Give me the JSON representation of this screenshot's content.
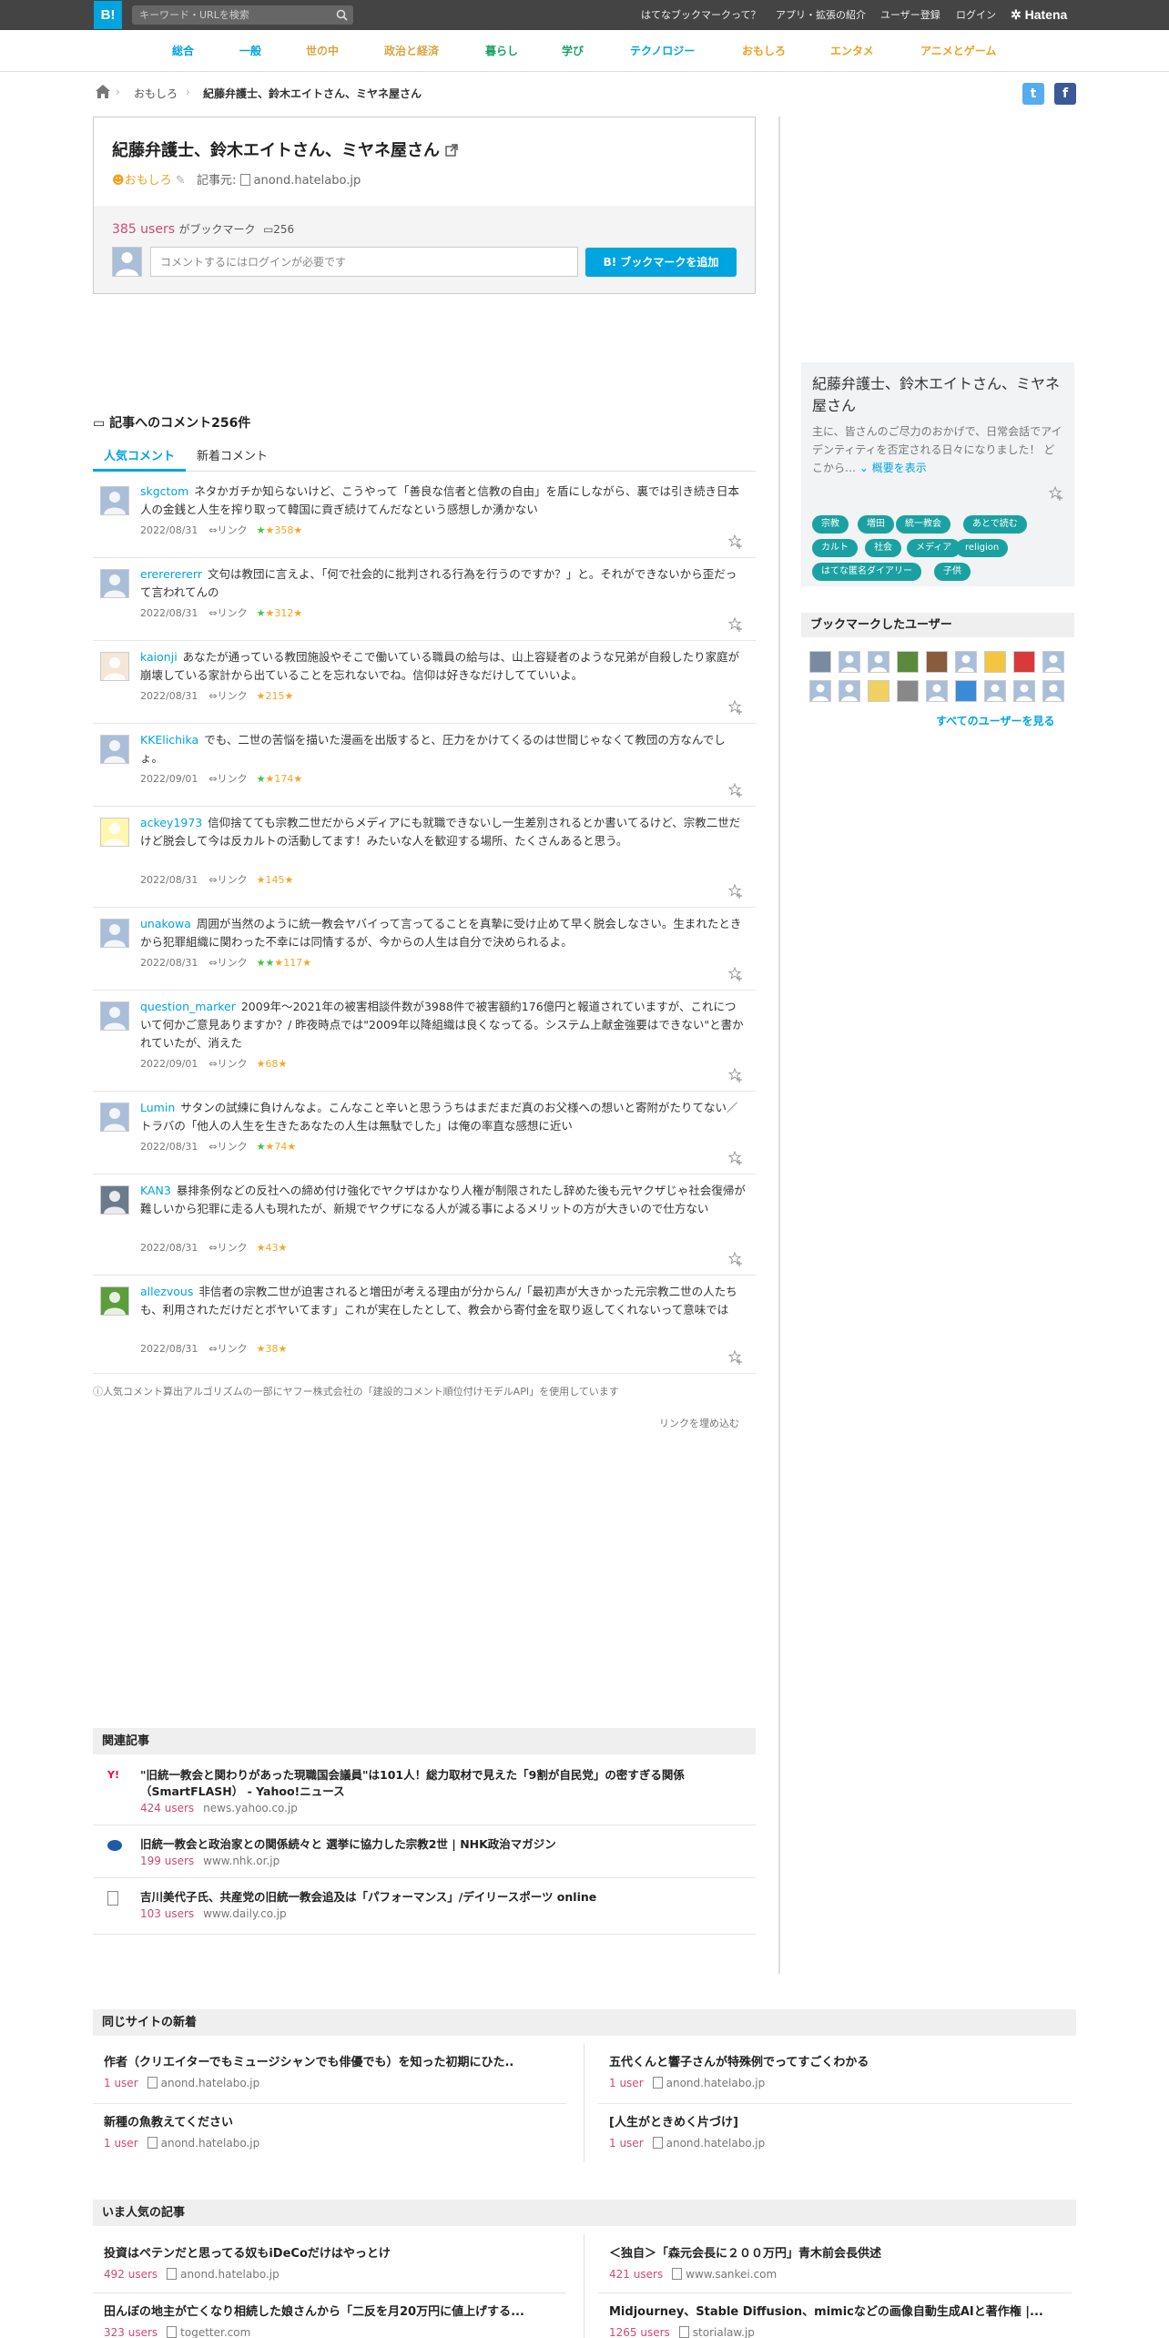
{
  "topbar": {
    "logo": "B!",
    "search_placeholder": "キーワード・URLを検索",
    "nav": [
      "はてなブックマークって？",
      "アプリ・拡張の紹介",
      "ユーザー登録",
      "ログイン"
    ],
    "brand": "Hatena"
  },
  "categories": [
    {
      "label": "総合",
      "color": "#00a4de"
    },
    {
      "label": "一般",
      "color": "#00a4de"
    },
    {
      "label": "世の中",
      "color": "#d9a441"
    },
    {
      "label": "政治と経済",
      "color": "#d9a441"
    },
    {
      "label": "暮らし",
      "color": "#1ba167"
    },
    {
      "label": "学び",
      "color": "#1ba167"
    },
    {
      "label": "テクノロジー",
      "color": "#00a4de"
    },
    {
      "label": "おもしろ",
      "color": "#f0a020"
    },
    {
      "label": "エンタメ",
      "color": "#f0a020"
    },
    {
      "label": "アニメとゲーム",
      "color": "#f0a020"
    }
  ],
  "breadcrumb": {
    "category": "おもしろ",
    "current": "紀藤弁護士、鈴木エイトさん、ミヤネ屋さん"
  },
  "entry": {
    "title": "紀藤弁護士、鈴木エイトさん、ミヤネ屋さん",
    "category": "おもしろ",
    "source_label": "記事元:",
    "source": "anond.hatelabo.jp",
    "users": "385 users",
    "bookmarked_suffix": "がブックマーク",
    "comment_count": "256",
    "comment_placeholder": "コメントするにはログインが必要です",
    "add_button": "ブックマークを追加"
  },
  "comments_section": {
    "heading": "記事へのコメント256件",
    "tab_popular": "人気コメント",
    "tab_new": "新着コメント"
  },
  "comments": [
    {
      "user": "skgctom",
      "text": "ネタかガチか知らないけど、こうやって「善良な信者と信教の自由」を盾にしながら、裏では引き続き日本人の金銭と人生を搾り取って韓国に貢ぎ続けてんだなという感想しか湧かない",
      "date": "2022/08/31",
      "link": "リンク",
      "stars": "358",
      "green": "★"
    },
    {
      "user": "erererererr",
      "text": "文句は教団に言えよ、「何で社会的に批判される行為を行うのですか？」と。それができないから歪だって言われてんの",
      "date": "2022/08/31",
      "link": "リンク",
      "stars": "312",
      "green": "★"
    },
    {
      "user": "kaionji",
      "text": "あなたが通っている教団施設やそこで働いている職員の給与は、山上容疑者のような兄弟が自殺したり家庭が崩壊している家計から出ていることを忘れないでね。信仰は好きなだけしてていいよ。",
      "date": "2022/08/31",
      "link": "リンク",
      "stars": "215",
      "green": ""
    },
    {
      "user": "KKElichika",
      "text": "でも、二世の苦悩を描いた漫画を出版すると、圧力をかけてくるのは世間じゃなくて教団の方なんでしょ。",
      "date": "2022/09/01",
      "link": "リンク",
      "stars": "174",
      "green": "★"
    },
    {
      "user": "ackey1973",
      "text": "信仰捨てても宗教二世だからメディアにも就職できないし一生差別されるとか書いてるけど、宗教二世だけど脱会して今は反カルトの活動してます！みたいな人を歓迎する場所、たくさんあると思う。",
      "date": "2022/08/31",
      "link": "リンク",
      "stars": "145",
      "green": ""
    },
    {
      "user": "unakowa",
      "text": "周囲が当然のように統一教会ヤバイって言ってることを真摯に受け止めて早く脱会しなさい。生まれたときから犯罪組織に関わった不幸には同情するが、今からの人生は自分で決められるよ。",
      "date": "2022/08/31",
      "link": "リンク",
      "stars": "117",
      "green": "★★"
    },
    {
      "user": "question_marker",
      "text": "2009年～2021年の被害相談件数が3988件で被害額約176億円と報道されていますが、これについて何かご意見ありますか？/ 昨夜時点では\"2009年以降組織は良くなってる。システム上献金強要はできない\"と書かれていたが、消えた",
      "date": "2022/09/01",
      "link": "リンク",
      "stars": "68",
      "green": ""
    },
    {
      "user": "Lumin",
      "text": "サタンの試練に負けんなよ。こんなこと辛いと思ううちはまだまだ真のお父様への想いと寄附がたりてない／トラバの「他人の人生を生きたあなたの人生は無駄でした」は俺の率直な感想に近い",
      "date": "2022/08/31",
      "link": "リンク",
      "stars": "74",
      "green": "★"
    },
    {
      "user": "KAN3",
      "text": "暴排条例などの反社への締め付け強化でヤクザはかなり人権が制限されたし辞めた後も元ヤクザじゃ社会復帰が難しいから犯罪に走る人も現れたが、新規でヤクザになる人が減る事によるメリットの方が大きいので仕方ない",
      "date": "2022/08/31",
      "link": "リンク",
      "stars": "43",
      "green": ""
    },
    {
      "user": "allezvous",
      "text": "非信者の宗教二世が迫害されると増田が考える理由が分からん/「最初声が大きかった元宗教二世の人たちも、利用されただけだとボヤいてます」これが実在したとして、教会から寄付金を取り返してくれないって意味では",
      "date": "2022/08/31",
      "link": "リンク",
      "stars": "38",
      "green": ""
    }
  ],
  "algo_note": "人気コメント算出アルゴリズムの一部にヤフー株式会社の「建設的コメント順位付けモデルAPI」を使用しています",
  "embed_link": "リンクを埋め込む",
  "related": {
    "heading": "関連記事",
    "items": [
      {
        "title": "\"旧統一教会と関わりがあった現職国会議員\"は101人！総力取材で見えた「9割が自民党」の密すぎる関係（SmartFLASH） - Yahoo!ニュース",
        "users": "424 users",
        "domain": "news.yahoo.co.jp"
      },
      {
        "title": "旧統一教会と政治家との関係続々と 選挙に協力した宗教2世 | NHK政治マガジン",
        "users": "199 users",
        "domain": "www.nhk.or.jp"
      },
      {
        "title": "吉川美代子氏、共産党の旧統一教会追及は「パフォーマンス」/デイリースポーツ online",
        "users": "103 users",
        "domain": "www.daily.co.jp"
      }
    ]
  },
  "sidebar": {
    "title": "紀藤弁護士、鈴木エイトさん、ミヤネ屋さん",
    "desc": "主に、皆さんのご尽力のおかげで、日常会話でアイデンティティを否定される日々になりました！ どこから…",
    "more": "概要を表示",
    "tags": [
      "宗教",
      "増田",
      "統一教会",
      "あとで読む",
      "カルト",
      "社会",
      "メディア",
      "religion",
      "はてな匿名ダイアリー",
      "子供"
    ],
    "users_heading": "ブックマークしたユーザー",
    "see_all": "すべてのユーザーを見る"
  },
  "same_site": {
    "heading": "同じサイトの新着",
    "items": [
      {
        "title": "作者（クリエイターでもミュージシャンでも俳優でも）を知った初期にひた..",
        "users": "1 user",
        "domain": "anond.hatelabo.jp"
      },
      {
        "title": "五代くんと響子さんが特殊例でってすごくわかる",
        "users": "1 user",
        "domain": "anond.hatelabo.jp"
      },
      {
        "title": "新種の魚教えてください",
        "users": "1 user",
        "domain": "anond.hatelabo.jp"
      },
      {
        "title": "[人生がときめく片づけ]",
        "users": "1 user",
        "domain": "anond.hatelabo.jp"
      }
    ]
  },
  "popular": {
    "heading": "いま人気の記事",
    "items": [
      {
        "title": "投資はペテンだと思ってる奴もiDeCoだけはやっとけ",
        "users": "492 users",
        "domain": "anond.hatelabo.jp"
      },
      {
        "title": "＜独自＞「森元会長に２００万円」青木前会長供述",
        "users": "421 users",
        "domain": "www.sankei.com"
      },
      {
        "title": "田んぼの地主が亡くなり相続した娘さんから「二反を月20万円に値上げする...",
        "users": "323 users",
        "domain": "togetter.com"
      },
      {
        "title": "Midjourney、Stable Diffusion、mimicなどの画像自動生成AIと著作権 |...",
        "users": "1265 users",
        "domain": "storialaw.jp"
      }
    ]
  }
}
